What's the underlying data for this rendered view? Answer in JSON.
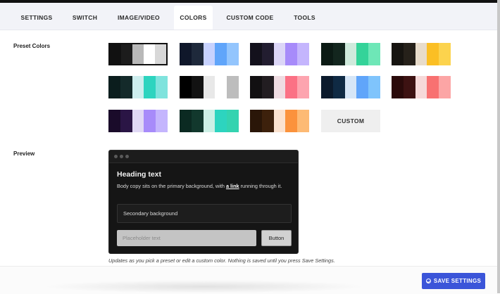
{
  "tabs": [
    {
      "label": "SETTINGS"
    },
    {
      "label": "SWITCH"
    },
    {
      "label": "IMAGE/VIDEO"
    },
    {
      "label": "COLORS",
      "active": true
    },
    {
      "label": "CUSTOM CODE"
    },
    {
      "label": "TOOLS"
    }
  ],
  "preset_colors": {
    "label": "Preset Colors",
    "custom_label": "CUSTOM",
    "swatches": [
      {
        "colors": [
          "#111111",
          "#1c1c1c",
          "#b8b8b8",
          "#ffffff",
          "#d8d8d8"
        ],
        "selected": true
      },
      {
        "colors": [
          "#0f172a",
          "#1e293b",
          "#c7d2fe",
          "#60a5fa",
          "#93c5fd"
        ]
      },
      {
        "colors": [
          "#13111c",
          "#221d30",
          "#dcd6f7",
          "#a78bfa",
          "#c4b5fd"
        ]
      },
      {
        "colors": [
          "#0b1a14",
          "#13261e",
          "#cfeadc",
          "#34d399",
          "#6ee7b7"
        ]
      },
      {
        "colors": [
          "#161410",
          "#26211a",
          "#e8dccb",
          "#fbbf24",
          "#fcd34d"
        ]
      },
      {
        "colors": [
          "#0b1d1d",
          "#142a2a",
          "#cdeeee",
          "#2dd4bf",
          "#7fe3dd"
        ]
      },
      {
        "colors": [
          "#000000",
          "#121212",
          "#e8e8e8",
          "#ffffff",
          "#bdbdbd"
        ]
      },
      {
        "colors": [
          "#121012",
          "#221d21",
          "#efdce2",
          "#fb7185",
          "#fda4af"
        ]
      },
      {
        "colors": [
          "#0b1a2c",
          "#0f2a44",
          "#d6e6f7",
          "#60a5fa",
          "#7fc4fc"
        ]
      },
      {
        "colors": [
          "#2a0a0a",
          "#3d1212",
          "#f6d9d9",
          "#f87171",
          "#fca5a5"
        ]
      },
      {
        "colors": [
          "#1a0b2a",
          "#2a1545",
          "#e0d8f5",
          "#a78bfa",
          "#c4b5fd"
        ]
      },
      {
        "colors": [
          "#0b2a22",
          "#12382d",
          "#cdf0e6",
          "#2dd4bf",
          "#34d3b0"
        ]
      },
      {
        "colors": [
          "#2a1608",
          "#3d210c",
          "#fbe2cf",
          "#fb923c",
          "#fdba74"
        ]
      }
    ]
  },
  "preview": {
    "label": "Preview",
    "heading": "Heading text",
    "body_prefix": "Body copy sits on the primary background, with ",
    "link_text": "a link",
    "body_suffix": " running through it.",
    "secondary_text": "Secondary background",
    "input_placeholder": "Placeholder text",
    "button_label": "Button",
    "note": "Updates as you pick a preset or edit a custom color. Nothing is saved until you press Save Settings."
  },
  "footer": {
    "save_label": "SAVE SETTINGS"
  },
  "icons": {
    "save": "check-circle-icon",
    "window_dots": "window-dot-icon"
  }
}
